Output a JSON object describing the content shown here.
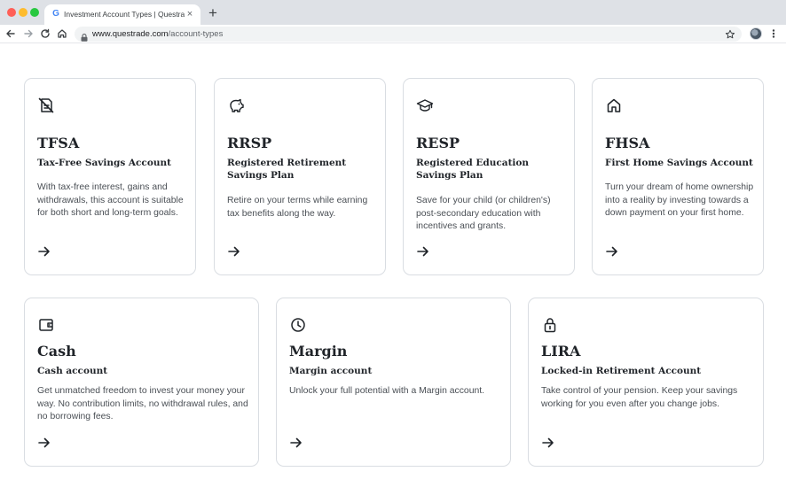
{
  "browser": {
    "tab_title": "Investment Account Types | Questrade",
    "tab_favicon": "G",
    "new_tab_glyph": "+",
    "close_glyph": "×",
    "url_domain": "www.questrade.com",
    "url_path": "/account-types"
  },
  "cards": [
    {
      "icon": "no-tax-document-icon",
      "title": "TFSA",
      "subtitle": "Tax-Free Savings Account",
      "description": "With tax-free interest, gains and withdrawals, this account is suitable for both short and long-term goals."
    },
    {
      "icon": "piggy-bank-icon",
      "title": "RRSP",
      "subtitle": "Registered Retirement Savings Plan",
      "description": "Retire on your terms while earning tax benefits along the way."
    },
    {
      "icon": "graduation-cap-icon",
      "title": "RESP",
      "subtitle": "Registered Education Savings Plan",
      "description": "Save for your child (or children's) post-secondary education with incentives and grants."
    },
    {
      "icon": "home-icon",
      "title": "FHSA",
      "subtitle": "First Home Savings Account",
      "description": "Turn your dream of home ownership into a reality by investing towards a down payment on your first home."
    },
    {
      "icon": "wallet-icon",
      "title": "Cash",
      "subtitle": "Cash account",
      "description": "Get unmatched freedom to invest your money your way. No contribution limits, no withdrawal rules, and no borrowing fees."
    },
    {
      "icon": "clock-icon",
      "title": "Margin",
      "subtitle": "Margin account",
      "description": "Unlock your full potential with a Margin account."
    },
    {
      "icon": "padlock-icon",
      "title": "LIRA",
      "subtitle": "Locked-in Retirement Account",
      "description": "Take control of your pension. Keep your savings working for you even after you change jobs."
    }
  ]
}
